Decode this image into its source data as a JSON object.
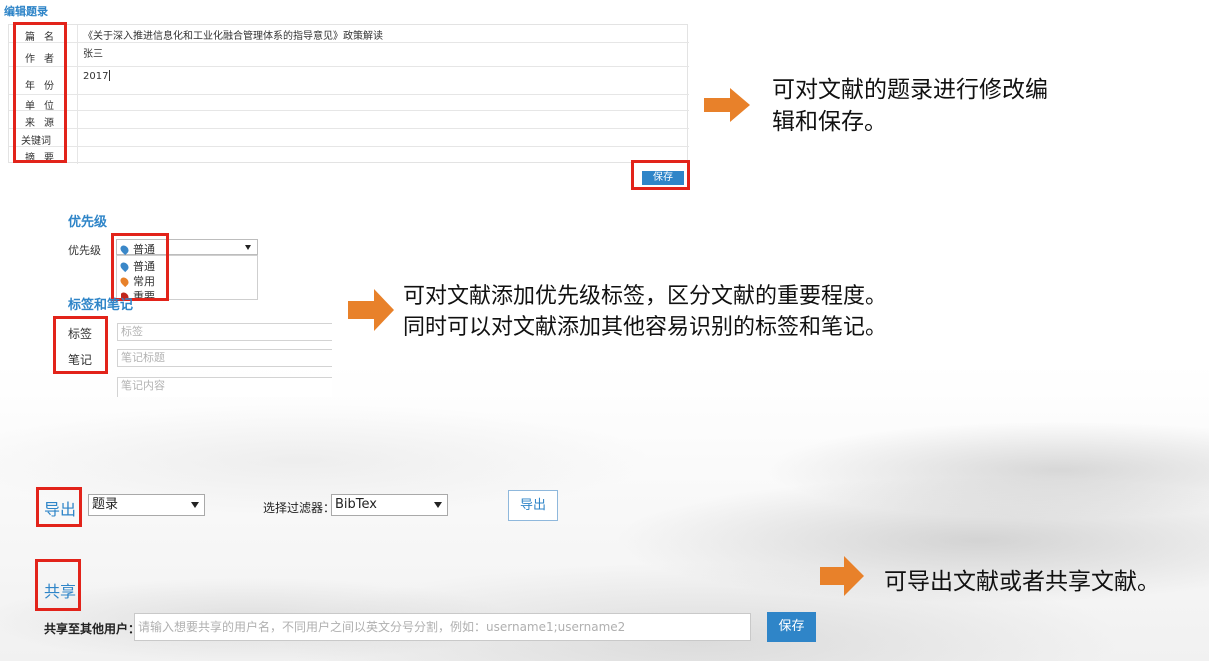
{
  "edit_record": {
    "title": "编辑题录",
    "fields": [
      {
        "label": "篇名",
        "value": "《关于深入推进信息化和工业化融合管理体系的指导意见》政策解读"
      },
      {
        "label": "作者",
        "value": "张三"
      },
      {
        "label": "年份",
        "value": "2017"
      },
      {
        "label": "单位",
        "value": ""
      },
      {
        "label": "来源",
        "value": ""
      },
      {
        "label": "关键词",
        "value": ""
      },
      {
        "label": "摘要",
        "value": ""
      }
    ],
    "save_label": "保存",
    "callout_lines": [
      "可对文献的题录进行修改编",
      "辑和保存。"
    ]
  },
  "priority": {
    "title": "优先级",
    "label": "优先级",
    "selected": "普通",
    "options": [
      {
        "label": "普通",
        "color": "#3a87c8"
      },
      {
        "label": "常用",
        "color": "#e8812a"
      },
      {
        "label": "重要",
        "color": "#c0271c"
      }
    ]
  },
  "tags_notes": {
    "title_visible": "标签和笔记",
    "tag_label": "标签",
    "tag_placeholder": "标签",
    "note_label": "笔记",
    "note_title_placeholder": "笔记标题",
    "note_content_placeholder": "笔记内容",
    "callout_lines": [
      "可对文献添加优先级标签，区分文献的重要程度。",
      "同时可以对文献添加其他容易识别的标签和笔记。"
    ]
  },
  "export": {
    "label": "导出",
    "format_value": "题录",
    "filter_label": "选择过滤器：",
    "filter_value": "BibTex",
    "button_label": "导出"
  },
  "share": {
    "label": "共享",
    "to_label": "共享至其他用户：",
    "input_placeholder": "请输入想要共享的用户名，不同用户之间以英文分号分割，例如：username1;username2",
    "save_label": "保存",
    "callout": "可导出文献或者共享文献。"
  },
  "colors": {
    "accent": "#2f85c8",
    "highlight": "#e2231a",
    "arrow": "#e8812a"
  }
}
